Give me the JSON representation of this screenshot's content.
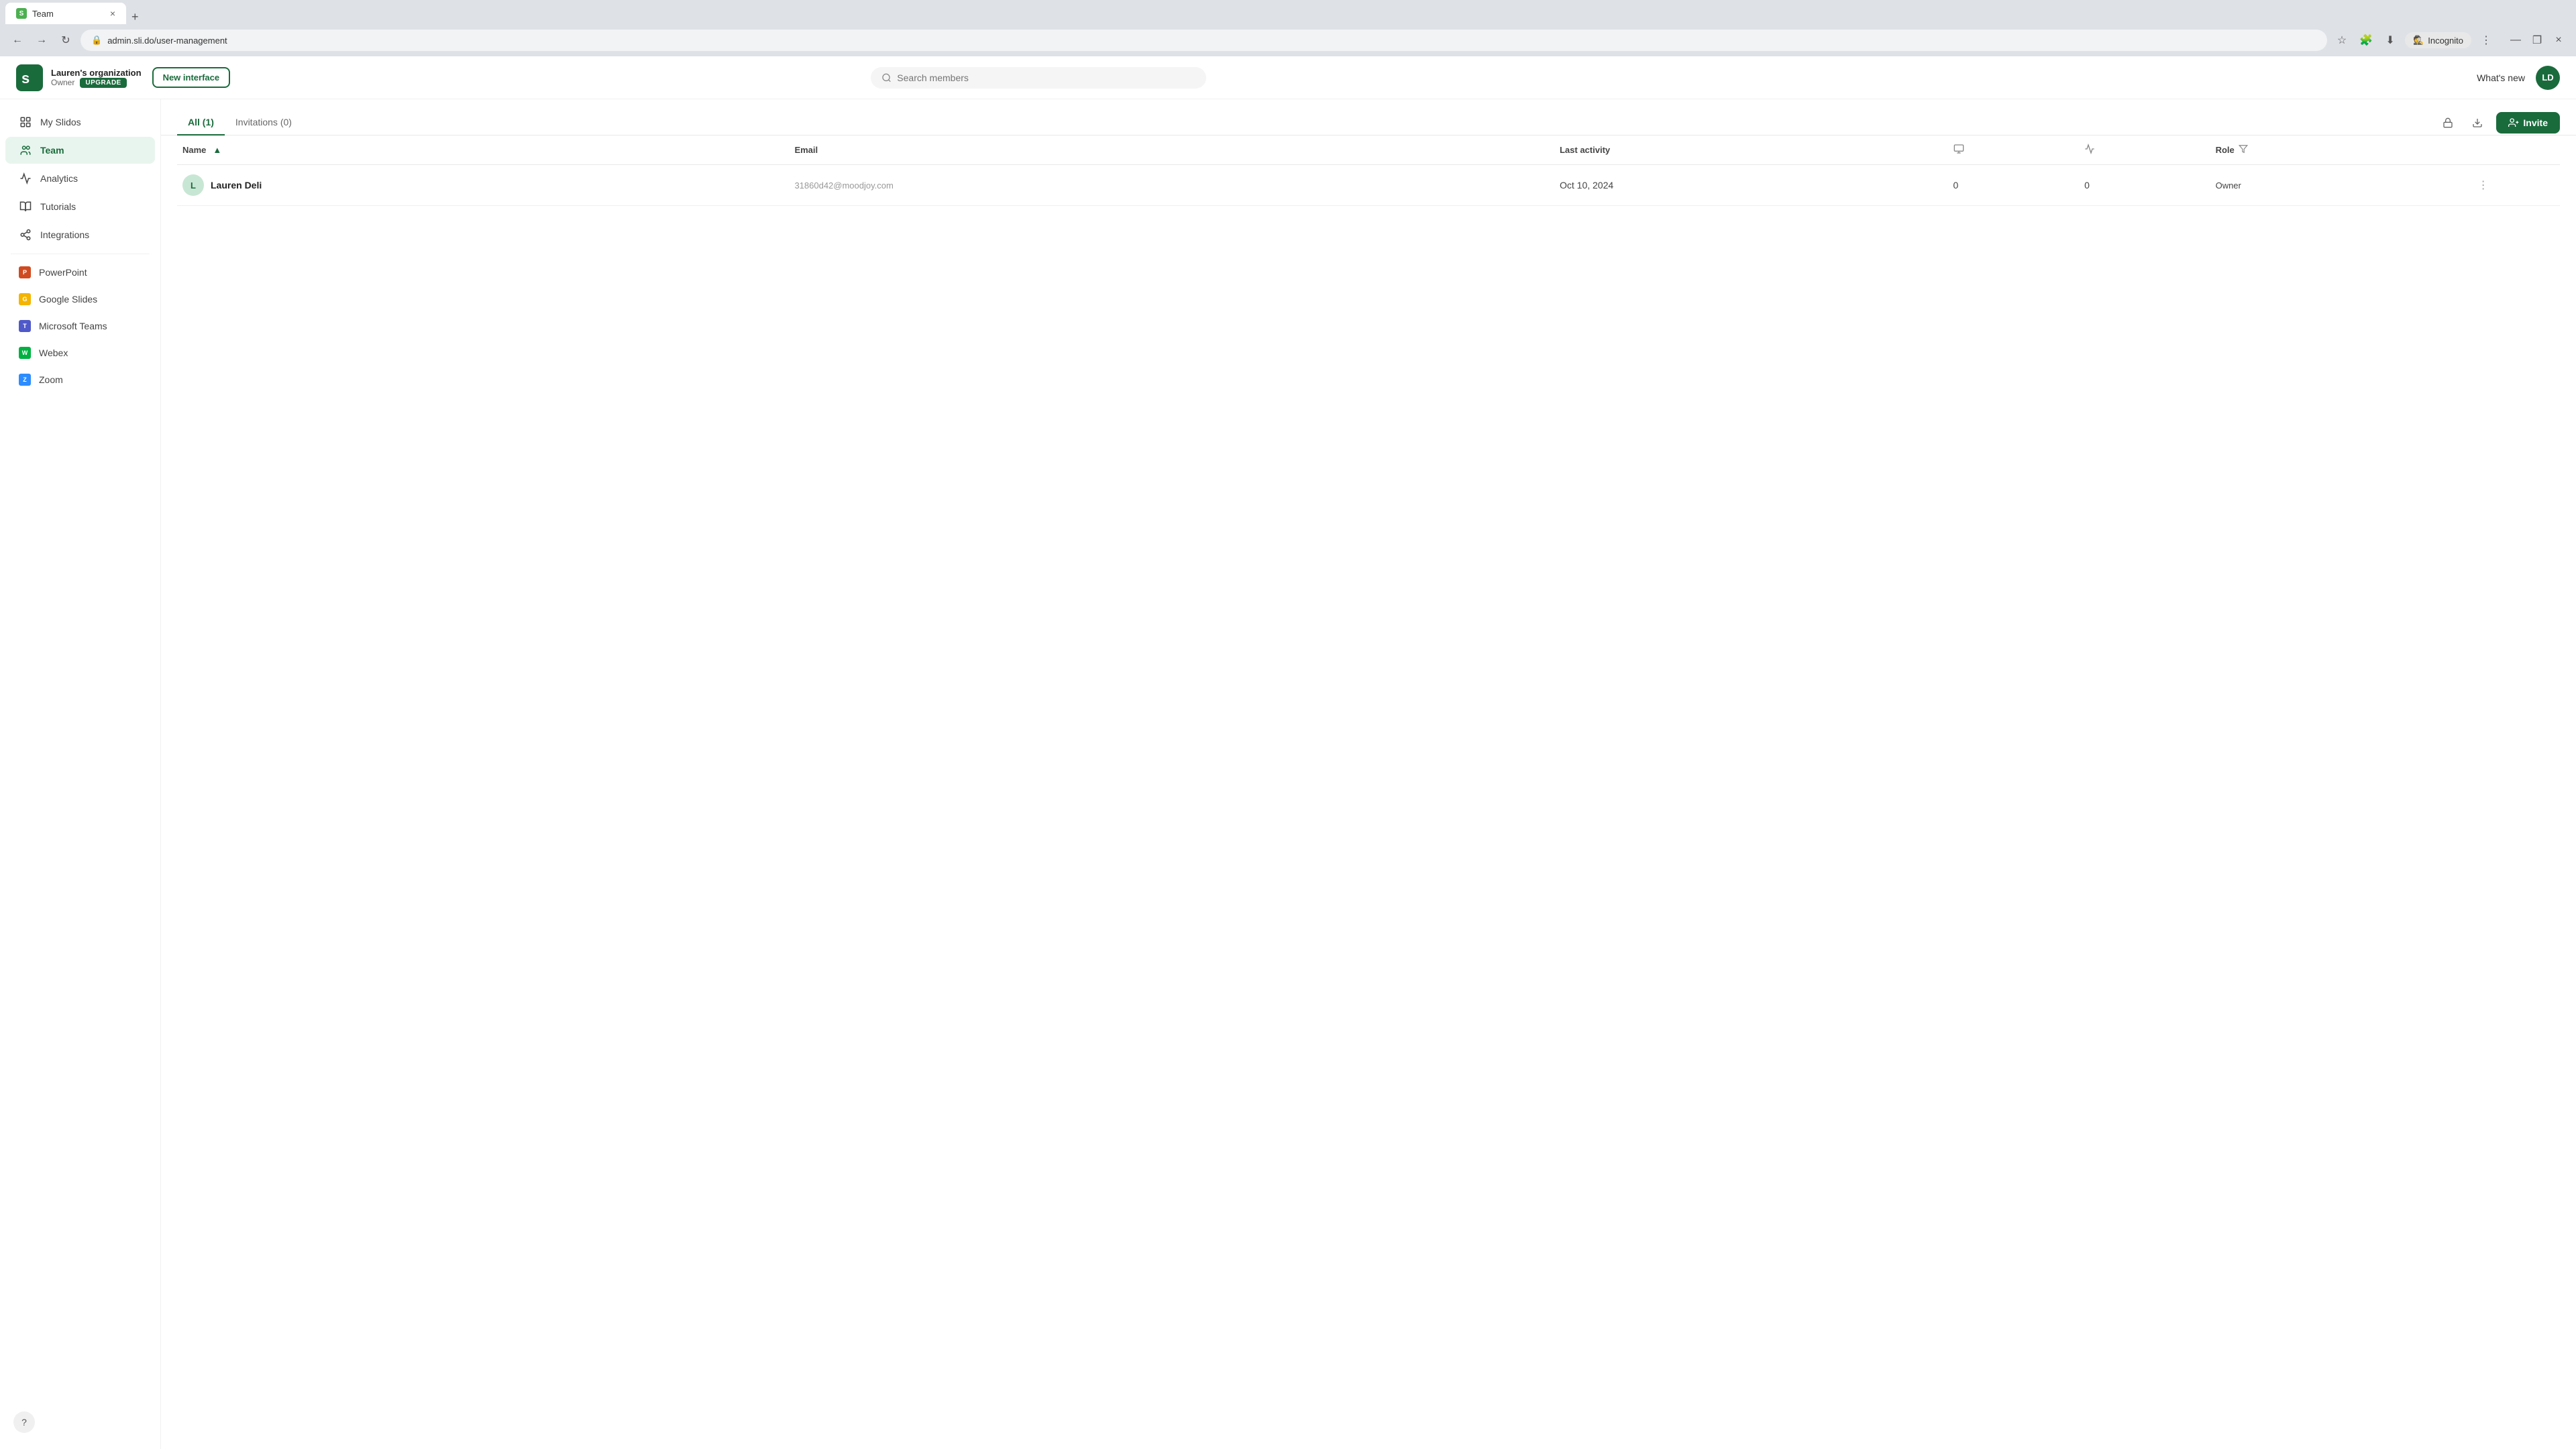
{
  "browser": {
    "tab_favicon": "S",
    "tab_title": "Team",
    "tab_close": "×",
    "new_tab": "+",
    "address": "admin.sli.do/user-management",
    "incognito_label": "Incognito",
    "window_minimize": "—",
    "window_maximize": "❐",
    "window_close": "×"
  },
  "header": {
    "org_name": "Lauren's organization",
    "org_role": "Owner",
    "upgrade_label": "UPGRADE",
    "new_interface_label": "New interface",
    "search_placeholder": "Search members",
    "whats_new_label": "What's new",
    "user_initials": "LD"
  },
  "sidebar": {
    "items": [
      {
        "id": "my-slidos",
        "label": "My Slidos",
        "active": false
      },
      {
        "id": "team",
        "label": "Team",
        "active": true
      },
      {
        "id": "analytics",
        "label": "Analytics",
        "active": false
      },
      {
        "id": "tutorials",
        "label": "Tutorials",
        "active": false
      },
      {
        "id": "integrations",
        "label": "Integrations",
        "active": false
      }
    ],
    "integrations": [
      {
        "id": "powerpoint",
        "label": "PowerPoint",
        "color": "#d04b1f"
      },
      {
        "id": "google-slides",
        "label": "Google Slides",
        "color": "#f4b400"
      },
      {
        "id": "microsoft-teams",
        "label": "Microsoft Teams",
        "color": "#5059c9"
      },
      {
        "id": "webex",
        "label": "Webex",
        "color": "#00b140"
      },
      {
        "id": "zoom",
        "label": "Zoom",
        "color": "#2d8cff"
      }
    ],
    "help_label": "?"
  },
  "content": {
    "tabs": [
      {
        "id": "all",
        "label": "All (1)",
        "active": true
      },
      {
        "id": "invitations",
        "label": "Invitations (0)",
        "active": false
      }
    ],
    "invite_label": "Invite",
    "columns": {
      "name": "Name",
      "email": "Email",
      "last_activity": "Last activity",
      "role": "Role"
    },
    "members": [
      {
        "avatar_initial": "L",
        "name": "Lauren Deli",
        "email": "31860d42@moodjoy.com",
        "last_activity": "Oct 10, 2024",
        "col1": "0",
        "col2": "0",
        "role": "Owner"
      }
    ]
  }
}
